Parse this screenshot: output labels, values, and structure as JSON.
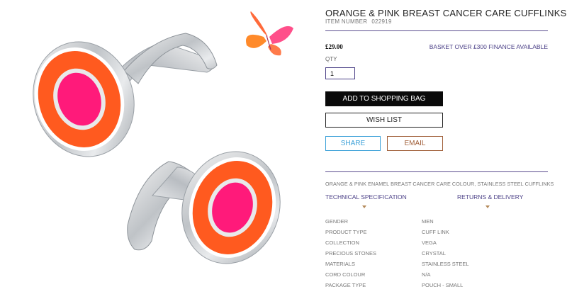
{
  "product": {
    "title": "ORANGE & PINK BREAST CANCER CARE CUFFLINKS",
    "item_number_label": "ITEM NUMBER",
    "item_number": "022919",
    "price": "£29.00",
    "finance_text": "BASKET OVER £300 FINANCE AVAILABLE",
    "qty_label": "QTY",
    "qty_value": "1",
    "add_to_bag_label": "ADD TO SHOPPING BAG",
    "wishlist_label": "WISH LIST",
    "share_label": "SHARE",
    "email_label": "EMAIL",
    "description": "ORANGE & PINK ENAMEL BREAST CANCER CARE COLOUR, STAINLESS STEEL CUFFLINKS"
  },
  "tabs": [
    {
      "label": "TECHNICAL SPECIFICATION"
    },
    {
      "label": "RETURNS & DELIVERY"
    }
  ],
  "specs": [
    {
      "key": "GENDER",
      "value": "MEN"
    },
    {
      "key": "PRODUCT TYPE",
      "value": "CUFF LINK"
    },
    {
      "key": "COLLECTION",
      "value": "VEGA"
    },
    {
      "key": "PRECIOUS STONES",
      "value": "CRYSTAL"
    },
    {
      "key": "MATERIALS",
      "value": "STAINLESS STEEL"
    },
    {
      "key": "CORD COLOUR",
      "value": "N/A"
    },
    {
      "key": "PACKAGE TYPE",
      "value": "POUCH - SMALL"
    }
  ],
  "colors": {
    "accent": "#4a3f86",
    "enamel_orange": "#ff5a1f",
    "enamel_pink": "#ff1a7a",
    "share_blue": "#3aa0d8",
    "email_brown": "#a1603a"
  }
}
